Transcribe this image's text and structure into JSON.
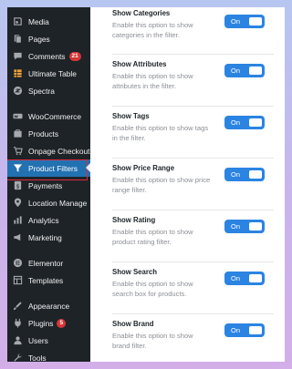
{
  "sidebar": {
    "items": [
      {
        "label": "Media",
        "icon": "media-icon"
      },
      {
        "label": "Pages",
        "icon": "pages-icon"
      },
      {
        "label": "Comments",
        "icon": "comments-icon",
        "badge": "21"
      },
      {
        "label": "Ultimate Table",
        "icon": "table-icon"
      },
      {
        "label": "Spectra",
        "icon": "spectra-icon"
      },
      {
        "label": "WooCommerce",
        "icon": "woocommerce-icon"
      },
      {
        "label": "Products",
        "icon": "products-icon"
      },
      {
        "label": "Onpage Checkout",
        "icon": "cart-icon"
      },
      {
        "label": "Product Filters",
        "icon": "filter-icon"
      },
      {
        "label": "Payments",
        "icon": "payments-icon"
      },
      {
        "label": "Location Manage",
        "icon": "location-icon"
      },
      {
        "label": "Analytics",
        "icon": "analytics-icon"
      },
      {
        "label": "Marketing",
        "icon": "marketing-icon"
      },
      {
        "label": "Elementor",
        "icon": "elementor-icon"
      },
      {
        "label": "Templates",
        "icon": "templates-icon"
      },
      {
        "label": "Appearance",
        "icon": "appearance-icon"
      },
      {
        "label": "Plugins",
        "icon": "plugins-icon",
        "badge": "5"
      },
      {
        "label": "Users",
        "icon": "users-icon"
      },
      {
        "label": "Tools",
        "icon": "tools-icon"
      }
    ],
    "active": "Product Filters",
    "highlight_color": "#e0283c"
  },
  "settings": [
    {
      "title": "Show Categories",
      "desc": "Enable this option to show categories in the filter.",
      "toggle": "On"
    },
    {
      "title": "Show Attributes",
      "desc": "Enable this option to show attributes in the filter.",
      "toggle": "On"
    },
    {
      "title": "Show Tags",
      "desc": "Enable this option to show tags in the filter.",
      "toggle": "On"
    },
    {
      "title": "Show Price Range",
      "desc": "Enable this option to show price range filter.",
      "toggle": "On"
    },
    {
      "title": "Show Rating",
      "desc": "Enable this option to show product rating filter.",
      "toggle": "On"
    },
    {
      "title": "Show Search",
      "desc": "Enable this option to show search box for products.",
      "toggle": "On"
    },
    {
      "title": "Show Brand",
      "desc": "Enable this option to show brand filter.",
      "toggle": "On"
    }
  ],
  "colors": {
    "toggle_on": "#2b84e2",
    "sidebar_bg": "#1d2327"
  }
}
